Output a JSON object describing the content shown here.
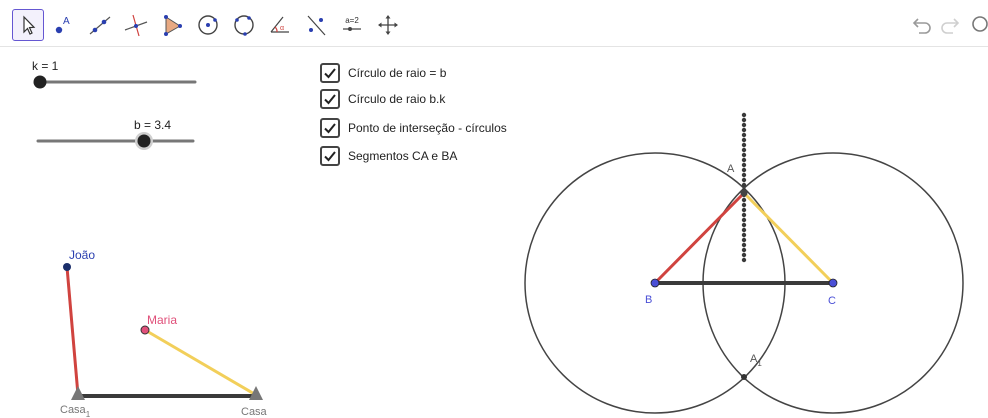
{
  "toolbar": {
    "tools": [
      {
        "name": "move-tool-icon",
        "active": true
      },
      {
        "name": "point-tool-icon",
        "active": false
      },
      {
        "name": "line-tool-icon",
        "active": false
      },
      {
        "name": "perpendicular-line-tool-icon",
        "active": false
      },
      {
        "name": "polygon-tool-icon",
        "active": false
      },
      {
        "name": "circle-center-point-tool-icon",
        "active": false
      },
      {
        "name": "circle-three-points-tool-icon",
        "active": false
      },
      {
        "name": "angle-tool-icon",
        "active": false
      },
      {
        "name": "reflect-about-line-tool-icon",
        "active": false
      },
      {
        "name": "slider-tool-icon",
        "active": false
      },
      {
        "name": "move-graphics-view-tool-icon",
        "active": false
      }
    ],
    "slider_icon_text": "a=2"
  },
  "sliders": {
    "k": {
      "label": "k = 1",
      "value": 1
    },
    "b": {
      "label": "b = 3.4",
      "value": 3.4
    }
  },
  "checkboxes": [
    {
      "label": "Círculo de raio = b",
      "checked": true
    },
    {
      "label": "Círculo de raio b.k",
      "checked": true
    },
    {
      "label": "Ponto de interseção - círculos",
      "checked": true
    },
    {
      "label": "Segmentos CA e BA",
      "checked": true
    }
  ],
  "left_figure": {
    "joao": "João",
    "maria": "Maria",
    "casa1_main": "Casa",
    "casa1_sub": "1",
    "casa2": "Casa"
  },
  "right_figure": {
    "A": "A",
    "B": "B",
    "C": "C",
    "A1_main": "A",
    "A1_sub": "1"
  },
  "colors": {
    "accent": "#6557d2",
    "red_segment": "#d0433f",
    "yellow_segment": "#f2cf5a",
    "point_blue": "#4a4fd6",
    "joao_point": "#1a2e6b",
    "maria_point": "#e0507a"
  }
}
